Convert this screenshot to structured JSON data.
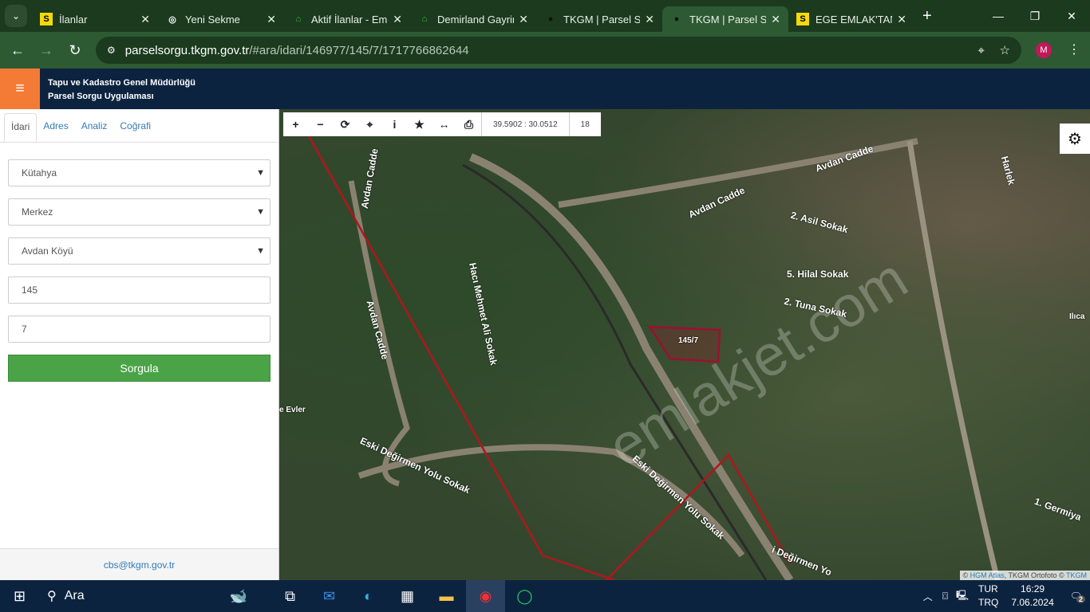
{
  "browser": {
    "tabs": [
      {
        "icon": "S",
        "label": "İlanlar"
      },
      {
        "icon": "chrome",
        "label": "Yeni Sekme"
      },
      {
        "icon": "house",
        "label": "Aktif İlanlar - Emlakjet"
      },
      {
        "icon": "house",
        "label": "Demirland Gayrimenkul"
      },
      {
        "icon": "pin",
        "label": "TKGM | Parsel Sorgu"
      },
      {
        "icon": "pin",
        "label": "TKGM | Parsel Sorgu",
        "active": true
      },
      {
        "icon": "S",
        "label": "EGE EMLAK'TAN"
      }
    ],
    "url_host": "parselsorgu.tkgm.gov.tr",
    "url_path": "/#ara/idari/146977/145/7/1717766862644",
    "profile": "M"
  },
  "app": {
    "title1": "Tapu ve Kadastro Genel Müdürlüğü",
    "title2": "Parsel Sorgu Uygulaması",
    "accent": "#f47b36"
  },
  "sidebar": {
    "tabs": [
      "İdari",
      "Adres",
      "Analiz",
      "Coğrafi"
    ],
    "il": "Kütahya",
    "ilce": "Merkez",
    "mahalle": "Avdan Köyü",
    "ada": "145",
    "parsel": "7",
    "button": "Sorgula",
    "footer": "cbs@tkgm.gov.tr"
  },
  "map": {
    "coords": "39.5902 : 30.0512",
    "zoom": "18",
    "parcel": "145/7",
    "labels": [
      "Avdan Cadde",
      "Avdan Cadde",
      "Avdan Cadde",
      "Avdan Cadde",
      "Hacı Mehmet Ali Sokak",
      "2. Asil Sokak",
      "5. Hilal Sokak",
      "2. Tuna Sokak",
      "Eski Değirmen Yolu Sokak",
      "Eski Değirmen Yolu Sokak",
      "i Değirmen Yo",
      "1. Germiya",
      "Harlek",
      "Ilıca",
      "e Evler",
      "Avdan Cadde"
    ],
    "watermark": "emlakjet.com",
    "attribution": {
      "a": "HGM Atlas",
      "b": ", TKGM Ortofoto © ",
      "c": "TKGM",
      "pre": "© "
    }
  },
  "taskbar": {
    "search": "Ara",
    "lang1": "TUR",
    "lang2": "TRQ",
    "time": "16:29",
    "date": "7.06.2024",
    "notif": "2"
  }
}
